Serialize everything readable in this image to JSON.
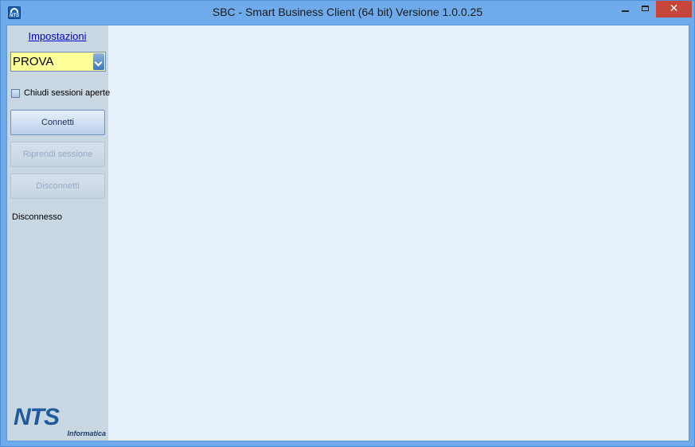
{
  "window": {
    "title": "SBC - Smart Business Client (64 bit)  Versione 1.0.0.25",
    "app_icon_text": "NTS"
  },
  "sidebar": {
    "settings_link": "Impostazioni",
    "profile_select": {
      "value": "PROVA"
    },
    "close_sessions_checkbox": {
      "label": "Chiudi sessioni aperte",
      "checked": false
    },
    "connect_button": "Connetti",
    "resume_button": "Riprendi sessione",
    "disconnect_button": "Disconnetti",
    "status_text": "Disconnesso",
    "logo": {
      "brand": "NTS",
      "subtitle": "Informatica"
    }
  },
  "colors": {
    "titlebar": "#6fabea",
    "close_button": "#c7463b",
    "sidebar": "#c9d7e3",
    "content_area": "#e6f0fb",
    "combo_bg": "#ffff99",
    "link": "#0000cc"
  }
}
